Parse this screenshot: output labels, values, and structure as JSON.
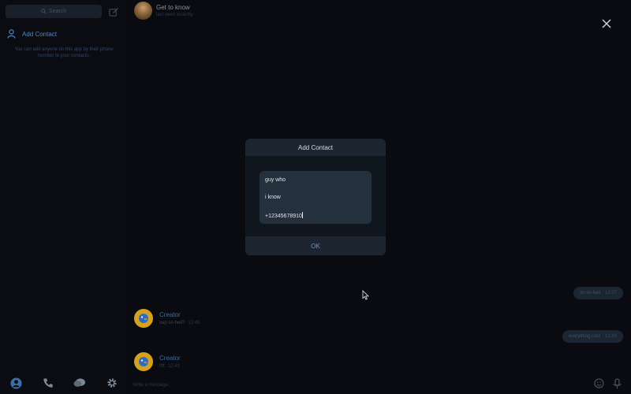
{
  "sidebar": {
    "search_placeholder": "Search",
    "add_contact_label": "Add Contact",
    "add_contact_hint": "You can add anyone on this app by their phone number to your contacts."
  },
  "chat": {
    "title": "Get to know",
    "status": "last seen recently",
    "messages": [
      {
        "author": "Creator",
        "text": "sup sn-hell?",
        "time": "12:49"
      },
      {
        "author": "Creator",
        "text": "!!!!",
        "time": "12:49"
      }
    ],
    "outgoing": [
      {
        "text": "sn sn-hell",
        "time": "12:27"
      },
      {
        "text": "everything cool",
        "time": "12:48"
      }
    ],
    "composer_placeholder": "Write a message..."
  },
  "dialog": {
    "title": "Add Contact",
    "first_name": "guy who",
    "last_name": "i know",
    "phone": "+12345678910",
    "ok_label": "OK"
  },
  "colors": {
    "accent": "#5a9be0",
    "background": "#090b10",
    "dialog_bg": "#10161e",
    "field_bg": "#25303d"
  },
  "icons": [
    "search-icon",
    "compose-icon",
    "person-icon",
    "profile-icon",
    "phone-icon",
    "chats-icon",
    "settings-icon",
    "close-icon",
    "emoji-icon",
    "mic-icon",
    "mouse-cursor-icon"
  ]
}
